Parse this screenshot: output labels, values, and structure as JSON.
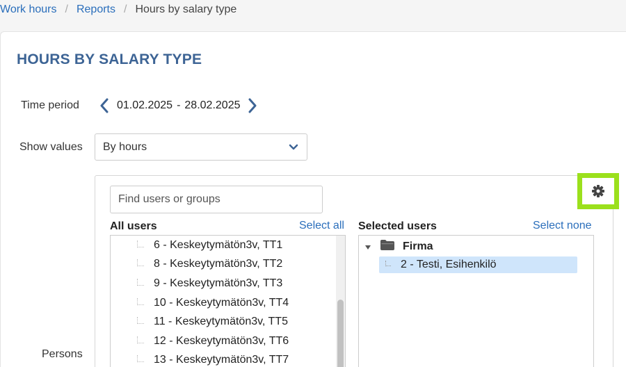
{
  "breadcrumb": {
    "items": [
      "Work hours",
      "Reports"
    ],
    "current": "Hours by salary type",
    "separator": "/"
  },
  "page": {
    "title": "HOURS BY SALARY TYPE"
  },
  "time_period": {
    "label": "Time period",
    "start": "01.02.2025",
    "dash": "-",
    "end": "28.02.2025"
  },
  "show_values": {
    "label": "Show values",
    "selected": "By hours"
  },
  "persons": {
    "label": "Persons",
    "search_placeholder": "Find users or groups",
    "all_users_header": "All users",
    "select_all": "Select all",
    "selected_users_header": "Selected users",
    "select_none": "Select none",
    "all_users": [
      "6 - Keskeytymätön3v, TT1",
      "8 - Keskeytymätön3v, TT2",
      "9 - Keskeytymätön3v, TT3",
      "10 - Keskeytymätön3v, TT4",
      "11 - Keskeytymätön3v, TT5",
      "12 - Keskeytymätön3v, TT6",
      "13 - Keskeytymätön3v, TT7"
    ],
    "selected_group": "Firma",
    "selected_users": [
      "2 - Testi, Esihenkilö"
    ]
  },
  "colors": {
    "accent": "#3d6495",
    "link": "#2a6ebb",
    "highlight": "#9be01c",
    "selection": "#cfe5fb"
  },
  "icons": [
    "chevron-left-icon",
    "chevron-right-icon",
    "chevron-down-icon",
    "gear-icon",
    "folder-icon",
    "caret-down-icon"
  ]
}
